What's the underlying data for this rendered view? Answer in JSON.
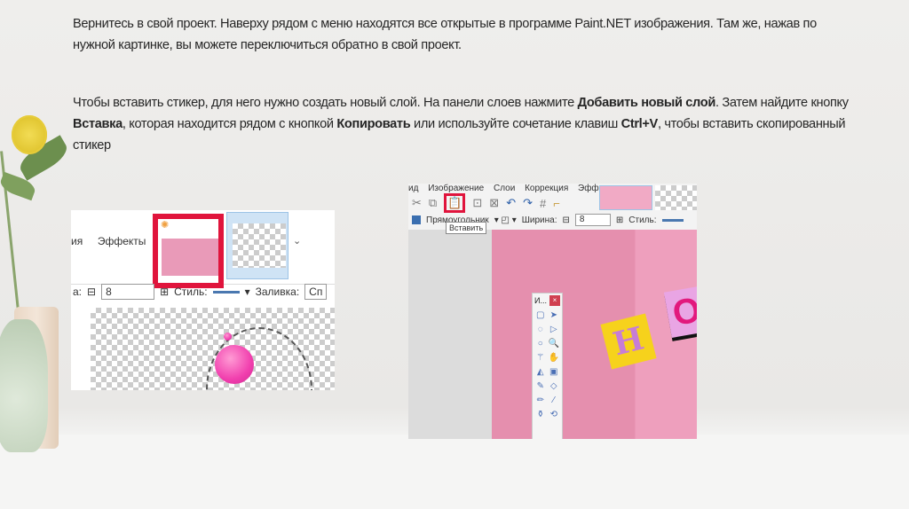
{
  "slide": {
    "paragraph1": "Вернитесь в свой проект. Наверху рядом с меню находятся все открытые в программе Paint.NET изображения. Там же, нажав по нужной картинке, вы можете переключиться обратно в свой проект.",
    "p2_part1": "Чтобы вставить стикер, для него нужно создать новый слой. На панели слоев нажмите ",
    "p2_bold1": "Добавить новый слой",
    "p2_part2": ". Затем найдите кнопку ",
    "p2_bold2": "Вставка",
    "p2_part3": ", которая находится рядом с кнопкой ",
    "p2_bold3": "Копировать",
    "p2_part4": " или используйте сочетание клавиш ",
    "p2_bold4": "Ctrl+V",
    "p2_part5": ", чтобы вставить скопированный стикер"
  },
  "left_screenshot": {
    "menu_partial": "ия",
    "menu_effects": "Эффекты",
    "width_label": "а:",
    "width_value": "8",
    "style_label": "Стиль:",
    "fill_label": "Заливка:",
    "fill_value": "Сп"
  },
  "right_screenshot": {
    "menu": "ид Изображение Слои Коррекция Эффекты",
    "shape_label": "Прямоугольник",
    "width_label": "Ширина:",
    "width_value": "8",
    "style_label": "Стиль:",
    "tooltip": "Вставить",
    "toolbox_title": "И...",
    "toolbox_close": "×",
    "sticker_h": "Н",
    "sticker_o": "О"
  }
}
